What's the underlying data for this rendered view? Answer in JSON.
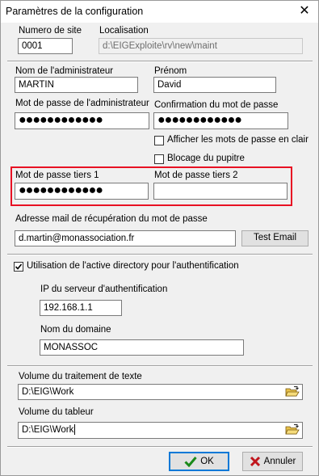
{
  "window": {
    "title": "Paramètres de la configuration"
  },
  "site": {
    "numero_label": "Numero de site",
    "numero_value": "0001",
    "localisation_label": "Localisation",
    "localisation_value": "d:\\EIGExploite\\rv\\new\\maint"
  },
  "admin": {
    "nom_label": "Nom  de l'administrateur",
    "nom_value": "MARTIN",
    "prenom_label": "Prénom",
    "prenom_value": "David",
    "mdp_label": "Mot de passe de l'administrateur",
    "mdp_value": "●●●●●●●●●●●●",
    "confirm_label": "Confirmation du mot de passe",
    "confirm_value": "●●●●●●●●●●●●",
    "afficher_label": "Afficher les mots de passe en clair",
    "blocage_label": "Blocage du pupitre"
  },
  "tiers": {
    "tiers1_label": "Mot de passe tiers 1",
    "tiers1_value": "●●●●●●●●●●●●",
    "tiers2_label": "Mot de passe tiers 2",
    "tiers2_value": ""
  },
  "mail": {
    "label": "Adresse mail de récupération du mot de passe",
    "value": "d.martin@monassociation.fr",
    "test_button": "Test Email"
  },
  "ad": {
    "checkbox_label": "Utilisation de l'active directory pour l'authentification",
    "checked": true,
    "ip_label": "IP du serveur d'authentification",
    "ip_value": "192.168.1.1",
    "domain_label": "Nom du domaine",
    "domain_value": "MONASSOC"
  },
  "volumes": {
    "texte_label": "Volume du traitement de texte",
    "texte_value": "D:\\EIG\\Work",
    "tableur_label": "Volume du tableur",
    "tableur_value": "D:\\EIG\\Work"
  },
  "buttons": {
    "ok": "OK",
    "annuler": "Annuler"
  },
  "colors": {
    "highlight_border": "#e81123",
    "ok_check": "#1a8a1a",
    "cancel_x": "#c0141b",
    "default_button_border": "#0078d7"
  }
}
